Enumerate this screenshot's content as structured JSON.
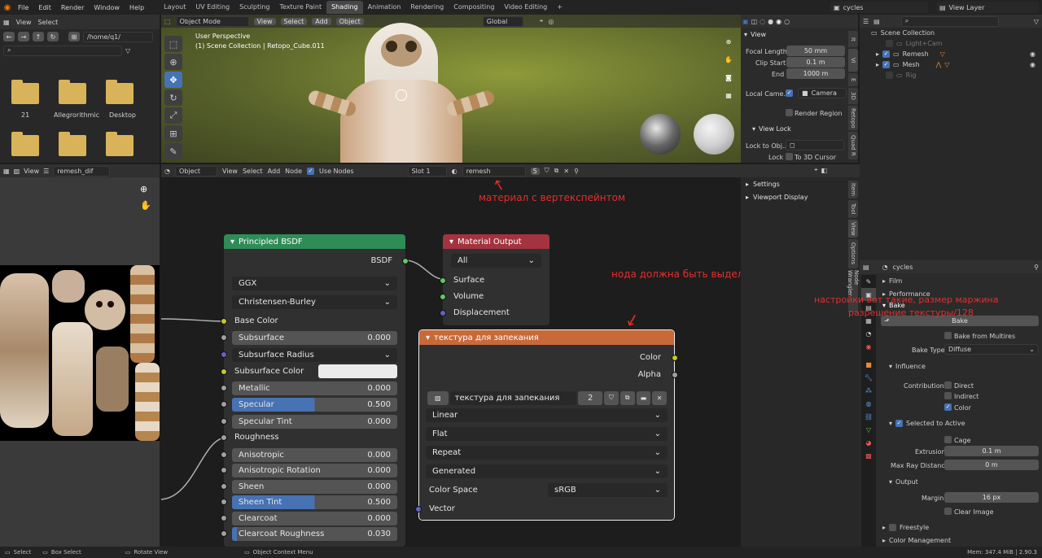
{
  "menu": [
    "File",
    "Edit",
    "Render",
    "Window",
    "Help"
  ],
  "workspaces": [
    "Layout",
    "UV Editing",
    "Sculpting",
    "Texture Paint",
    "Shading",
    "Animation",
    "Rendering",
    "Compositing",
    "Video Editing",
    "+"
  ],
  "active_workspace": "Shading",
  "scene": "cycles",
  "view_layer": "View Layer",
  "filebrowser": {
    "path": "/home/q1/",
    "items": [
      "21",
      "Allegrorithmic",
      "Desktop"
    ]
  },
  "viewport": {
    "mode": "Object Mode",
    "menus": [
      "View",
      "Select",
      "Add",
      "Object"
    ],
    "orient": "Global",
    "title": "User Perspective",
    "subtitle": "(1) Scene Collection | Retopo_Cube.011"
  },
  "view_panel": {
    "header": "View",
    "focal_label": "Focal Length",
    "focal": "50 mm",
    "clip_start_label": "Clip Start",
    "clip_start": "0.1 m",
    "end_label": "End",
    "end": "1000 m",
    "local_camera_label": "Local Came...",
    "camera": "Camera",
    "render_region": "Render Region",
    "view_lock": "View Lock",
    "lock_obj": "Lock to Obj...",
    "lock": "Lock",
    "to3d": "To 3D Cursor"
  },
  "npanel_tabs": [
    "It",
    "Vi",
    "E",
    "3D",
    "Retopo",
    "Quad R"
  ],
  "outliner": {
    "root": "Scene Collection",
    "items": [
      "Light+Cam",
      "Remesh",
      "Mesh",
      "Rig"
    ]
  },
  "image_editor": {
    "view": "View",
    "image": "remesh_dif",
    "label": "remesh"
  },
  "node_editor": {
    "mode": "Object",
    "menus": [
      "View",
      "Select",
      "Add",
      "Node"
    ],
    "use_nodes": "Use Nodes",
    "slot": "Slot 1",
    "material": "remesh",
    "users": "5"
  },
  "node_sidebar": {
    "settings": "Settings",
    "viewport_display": "Viewport Display",
    "tabs": [
      "Item",
      "Tool",
      "View",
      "Options",
      "Node Wrangler"
    ]
  },
  "annotations": {
    "material": "материал с вертекспейнтом",
    "node_selected": "нода должна быть выделена",
    "settings1": "настройки вот такие, размер маржина",
    "settings2": "разрешение текстуры/128"
  },
  "bsdf": {
    "title": "Principled BSDF",
    "output": "BSDF",
    "dist": "GGX",
    "sss": "Christensen-Burley",
    "base_color": "Base Color",
    "subsurface": "Subsurface",
    "subsurface_v": "0.000",
    "sss_radius": "Subsurface Radius",
    "sss_color": "Subsurface Color",
    "metallic": "Metallic",
    "metallic_v": "0.000",
    "specular": "Specular",
    "specular_v": "0.500",
    "spec_tint": "Specular Tint",
    "spec_tint_v": "0.000",
    "roughness": "Roughness",
    "aniso": "Anisotropic",
    "aniso_v": "0.000",
    "aniso_rot": "Anisotropic Rotation",
    "aniso_rot_v": "0.000",
    "sheen": "Sheen",
    "sheen_v": "0.000",
    "sheen_tint": "Sheen Tint",
    "sheen_tint_v": "0.500",
    "clearcoat": "Clearcoat",
    "clearcoat_v": "0.000",
    "cc_rough": "Clearcoat Roughness",
    "cc_rough_v": "0.030"
  },
  "matout": {
    "title": "Material Output",
    "target": "All",
    "surface": "Surface",
    "volume": "Volume",
    "displacement": "Displacement"
  },
  "texnode": {
    "title": "текстура для запекания",
    "color": "Color",
    "alpha": "Alpha",
    "image": "текстура для запекания",
    "users": "2",
    "interp": "Linear",
    "proj": "Flat",
    "ext": "Repeat",
    "src": "Generated",
    "cs_label": "Color Space",
    "cs": "sRGB",
    "vector": "Vector"
  },
  "props": {
    "engine": "cycles",
    "film": "Film",
    "performance": "Performance",
    "bake": "Bake",
    "bake_btn": "Bake",
    "from_multires": "Bake from Multires",
    "bake_type_label": "Bake Type",
    "bake_type": "Diffuse",
    "influence": "Influence",
    "contributions": "Contributions",
    "direct": "Direct",
    "indirect": "Indirect",
    "color": "Color",
    "selected_to_active": "Selected to Active",
    "cage": "Cage",
    "extrusion_label": "Extrusion",
    "extrusion": "0.1 m",
    "max_ray_label": "Max Ray Distance",
    "max_ray": "0 m",
    "output": "Output",
    "margin_label": "Margin",
    "margin": "16 px",
    "clear_image": "Clear Image",
    "freestyle": "Freestyle",
    "color_mgmt": "Color Management"
  },
  "status": {
    "select": "Select",
    "box": "Box Select",
    "rotate": "Rotate View",
    "context": "Object Context Menu",
    "mem": "Mem: 347.4 MiB | 2.90.3"
  }
}
